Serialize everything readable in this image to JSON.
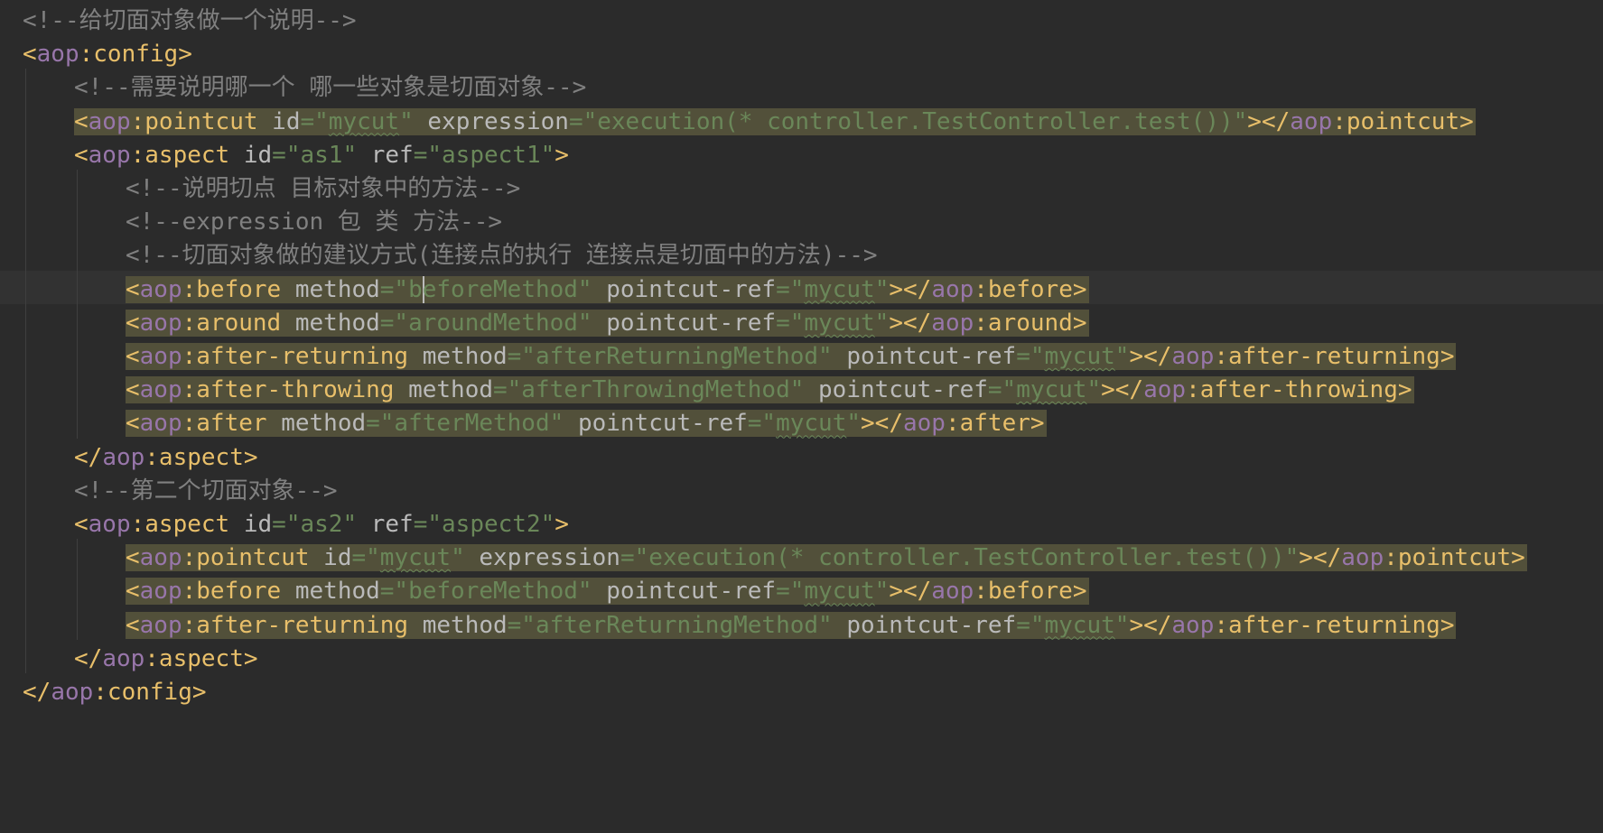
{
  "editor": {
    "language": "xml",
    "colors": {
      "background": "#2b2b2b",
      "current_line": "#323232",
      "comment": "#808080",
      "tag": "#e8bf6a",
      "namespace": "#9876aa",
      "attribute": "#bababa",
      "value": "#6a8759",
      "highlight": "#52503a"
    },
    "lines": [
      {
        "indent": 0,
        "highlight": false,
        "tokens": [
          {
            "k": "c",
            "t": "<!--给切面对象做一个说明-->"
          }
        ]
      },
      {
        "indent": 0,
        "highlight": false,
        "tokens": [
          {
            "k": "t",
            "t": "<"
          },
          {
            "k": "ns",
            "t": "aop"
          },
          {
            "k": "t",
            "t": ":config>"
          }
        ]
      },
      {
        "indent": 1,
        "highlight": false,
        "tokens": [
          {
            "k": "c",
            "t": "<!--需要说明哪一个 哪一些对象是切面对象-->"
          }
        ]
      },
      {
        "indent": 1,
        "highlight": true,
        "tokens": [
          {
            "k": "t",
            "t": "<"
          },
          {
            "k": "ns",
            "t": "aop"
          },
          {
            "k": "t",
            "t": ":pointcut "
          },
          {
            "k": "a",
            "t": "id"
          },
          {
            "k": "v",
            "t": "=\""
          },
          {
            "k": "vw",
            "t": "mycut"
          },
          {
            "k": "v",
            "t": "\" "
          },
          {
            "k": "a",
            "t": "expression"
          },
          {
            "k": "v",
            "t": "=\"execution(* controller.TestController.test())\""
          },
          {
            "k": "t",
            "t": "></"
          },
          {
            "k": "ns",
            "t": "aop"
          },
          {
            "k": "t",
            "t": ":pointcut>"
          }
        ]
      },
      {
        "indent": 1,
        "highlight": false,
        "tokens": [
          {
            "k": "t",
            "t": "<"
          },
          {
            "k": "ns",
            "t": "aop"
          },
          {
            "k": "t",
            "t": ":aspect "
          },
          {
            "k": "a",
            "t": "id"
          },
          {
            "k": "v",
            "t": "=\"as1\" "
          },
          {
            "k": "a",
            "t": "ref"
          },
          {
            "k": "v",
            "t": "=\"aspect1\""
          },
          {
            "k": "t",
            "t": ">"
          }
        ]
      },
      {
        "indent": 2,
        "highlight": false,
        "tokens": [
          {
            "k": "c",
            "t": "<!--说明切点 目标对象中的方法-->"
          }
        ]
      },
      {
        "indent": 2,
        "highlight": false,
        "tokens": [
          {
            "k": "c",
            "t": "<!--expression 包 类 方法-->"
          }
        ]
      },
      {
        "indent": 2,
        "highlight": false,
        "tokens": [
          {
            "k": "c",
            "t": "<!--切面对象做的建议方式(连接点的执行 连接点是切面中的方法)-->"
          }
        ]
      },
      {
        "indent": 2,
        "highlight": true,
        "current": true,
        "tokens": [
          {
            "k": "t",
            "t": "<"
          },
          {
            "k": "ns",
            "t": "aop"
          },
          {
            "k": "t",
            "t": ":before "
          },
          {
            "k": "a",
            "t": "method"
          },
          {
            "k": "v",
            "t": "=\"b"
          },
          {
            "k": "caret",
            "t": ""
          },
          {
            "k": "v",
            "t": "eforeMethod\" "
          },
          {
            "k": "a",
            "t": "pointcut-ref"
          },
          {
            "k": "v",
            "t": "=\""
          },
          {
            "k": "vw",
            "t": "mycut"
          },
          {
            "k": "v",
            "t": "\""
          },
          {
            "k": "t",
            "t": "></"
          },
          {
            "k": "ns",
            "t": "aop"
          },
          {
            "k": "t",
            "t": ":before>"
          }
        ]
      },
      {
        "indent": 2,
        "highlight": true,
        "tokens": [
          {
            "k": "t",
            "t": "<"
          },
          {
            "k": "ns",
            "t": "aop"
          },
          {
            "k": "t",
            "t": ":around "
          },
          {
            "k": "a",
            "t": "method"
          },
          {
            "k": "v",
            "t": "=\"aroundMethod\" "
          },
          {
            "k": "a",
            "t": "pointcut-ref"
          },
          {
            "k": "v",
            "t": "=\""
          },
          {
            "k": "vw",
            "t": "mycut"
          },
          {
            "k": "v",
            "t": "\""
          },
          {
            "k": "t",
            "t": "></"
          },
          {
            "k": "ns",
            "t": "aop"
          },
          {
            "k": "t",
            "t": ":around>"
          }
        ]
      },
      {
        "indent": 2,
        "highlight": true,
        "tokens": [
          {
            "k": "t",
            "t": "<"
          },
          {
            "k": "ns",
            "t": "aop"
          },
          {
            "k": "t",
            "t": ":after-returning "
          },
          {
            "k": "a",
            "t": "method"
          },
          {
            "k": "v",
            "t": "=\"afterReturningMethod\" "
          },
          {
            "k": "a",
            "t": "pointcut-ref"
          },
          {
            "k": "v",
            "t": "=\""
          },
          {
            "k": "vw",
            "t": "mycut"
          },
          {
            "k": "v",
            "t": "\""
          },
          {
            "k": "t",
            "t": "></"
          },
          {
            "k": "ns",
            "t": "aop"
          },
          {
            "k": "t",
            "t": ":after-returning>"
          }
        ]
      },
      {
        "indent": 2,
        "highlight": true,
        "tokens": [
          {
            "k": "t",
            "t": "<"
          },
          {
            "k": "ns",
            "t": "aop"
          },
          {
            "k": "t",
            "t": ":after-throwing "
          },
          {
            "k": "a",
            "t": "method"
          },
          {
            "k": "v",
            "t": "=\"afterThrowingMethod\" "
          },
          {
            "k": "a",
            "t": "pointcut-ref"
          },
          {
            "k": "v",
            "t": "=\""
          },
          {
            "k": "vw",
            "t": "mycut"
          },
          {
            "k": "v",
            "t": "\""
          },
          {
            "k": "t",
            "t": "></"
          },
          {
            "k": "ns",
            "t": "aop"
          },
          {
            "k": "t",
            "t": ":after-throwing>"
          }
        ]
      },
      {
        "indent": 2,
        "highlight": true,
        "tokens": [
          {
            "k": "t",
            "t": "<"
          },
          {
            "k": "ns",
            "t": "aop"
          },
          {
            "k": "t",
            "t": ":after "
          },
          {
            "k": "a",
            "t": "method"
          },
          {
            "k": "v",
            "t": "=\"afterMethod\" "
          },
          {
            "k": "a",
            "t": "pointcut-ref"
          },
          {
            "k": "v",
            "t": "=\""
          },
          {
            "k": "vw",
            "t": "mycut"
          },
          {
            "k": "v",
            "t": "\""
          },
          {
            "k": "t",
            "t": "></"
          },
          {
            "k": "ns",
            "t": "aop"
          },
          {
            "k": "t",
            "t": ":after>"
          }
        ]
      },
      {
        "indent": 1,
        "highlight": false,
        "tokens": [
          {
            "k": "t",
            "t": "</"
          },
          {
            "k": "ns",
            "t": "aop"
          },
          {
            "k": "t",
            "t": ":aspect>"
          }
        ]
      },
      {
        "indent": 1,
        "highlight": false,
        "tokens": [
          {
            "k": "c",
            "t": "<!--第二个切面对象-->"
          }
        ]
      },
      {
        "indent": 1,
        "highlight": false,
        "tokens": [
          {
            "k": "t",
            "t": "<"
          },
          {
            "k": "ns",
            "t": "aop"
          },
          {
            "k": "t",
            "t": ":aspect "
          },
          {
            "k": "a",
            "t": "id"
          },
          {
            "k": "v",
            "t": "=\"as2\" "
          },
          {
            "k": "a",
            "t": "ref"
          },
          {
            "k": "v",
            "t": "=\"aspect2\""
          },
          {
            "k": "t",
            "t": ">"
          }
        ]
      },
      {
        "indent": 2,
        "highlight": true,
        "tokens": [
          {
            "k": "t",
            "t": "<"
          },
          {
            "k": "ns",
            "t": "aop"
          },
          {
            "k": "t",
            "t": ":pointcut "
          },
          {
            "k": "a",
            "t": "id"
          },
          {
            "k": "v",
            "t": "=\""
          },
          {
            "k": "vw",
            "t": "mycut"
          },
          {
            "k": "v",
            "t": "\" "
          },
          {
            "k": "a",
            "t": "expression"
          },
          {
            "k": "v",
            "t": "=\"execution(* controller.TestController.test())\""
          },
          {
            "k": "t",
            "t": "></"
          },
          {
            "k": "ns",
            "t": "aop"
          },
          {
            "k": "t",
            "t": ":pointcut>"
          }
        ]
      },
      {
        "indent": 2,
        "highlight": true,
        "tokens": [
          {
            "k": "t",
            "t": "<"
          },
          {
            "k": "ns",
            "t": "aop"
          },
          {
            "k": "t",
            "t": ":before "
          },
          {
            "k": "a",
            "t": "method"
          },
          {
            "k": "v",
            "t": "=\"beforeMethod\" "
          },
          {
            "k": "a",
            "t": "pointcut-ref"
          },
          {
            "k": "v",
            "t": "=\""
          },
          {
            "k": "vw",
            "t": "mycut"
          },
          {
            "k": "v",
            "t": "\""
          },
          {
            "k": "t",
            "t": "></"
          },
          {
            "k": "ns",
            "t": "aop"
          },
          {
            "k": "t",
            "t": ":before>"
          }
        ]
      },
      {
        "indent": 2,
        "highlight": true,
        "tokens": [
          {
            "k": "t",
            "t": "<"
          },
          {
            "k": "ns",
            "t": "aop"
          },
          {
            "k": "t",
            "t": ":after-returning "
          },
          {
            "k": "a",
            "t": "method"
          },
          {
            "k": "v",
            "t": "=\"afterReturningMethod\" "
          },
          {
            "k": "a",
            "t": "pointcut-ref"
          },
          {
            "k": "v",
            "t": "=\""
          },
          {
            "k": "vw",
            "t": "mycut"
          },
          {
            "k": "v",
            "t": "\""
          },
          {
            "k": "t",
            "t": "></"
          },
          {
            "k": "ns",
            "t": "aop"
          },
          {
            "k": "t",
            "t": ":after-returning>"
          }
        ]
      },
      {
        "indent": 1,
        "highlight": false,
        "tokens": [
          {
            "k": "t",
            "t": "</"
          },
          {
            "k": "ns",
            "t": "aop"
          },
          {
            "k": "t",
            "t": ":aspect>"
          }
        ]
      },
      {
        "indent": 0,
        "highlight": false,
        "tokens": [
          {
            "k": "t",
            "t": "</"
          },
          {
            "k": "ns",
            "t": "aop"
          },
          {
            "k": "t",
            "t": ":config>"
          }
        ]
      }
    ]
  }
}
